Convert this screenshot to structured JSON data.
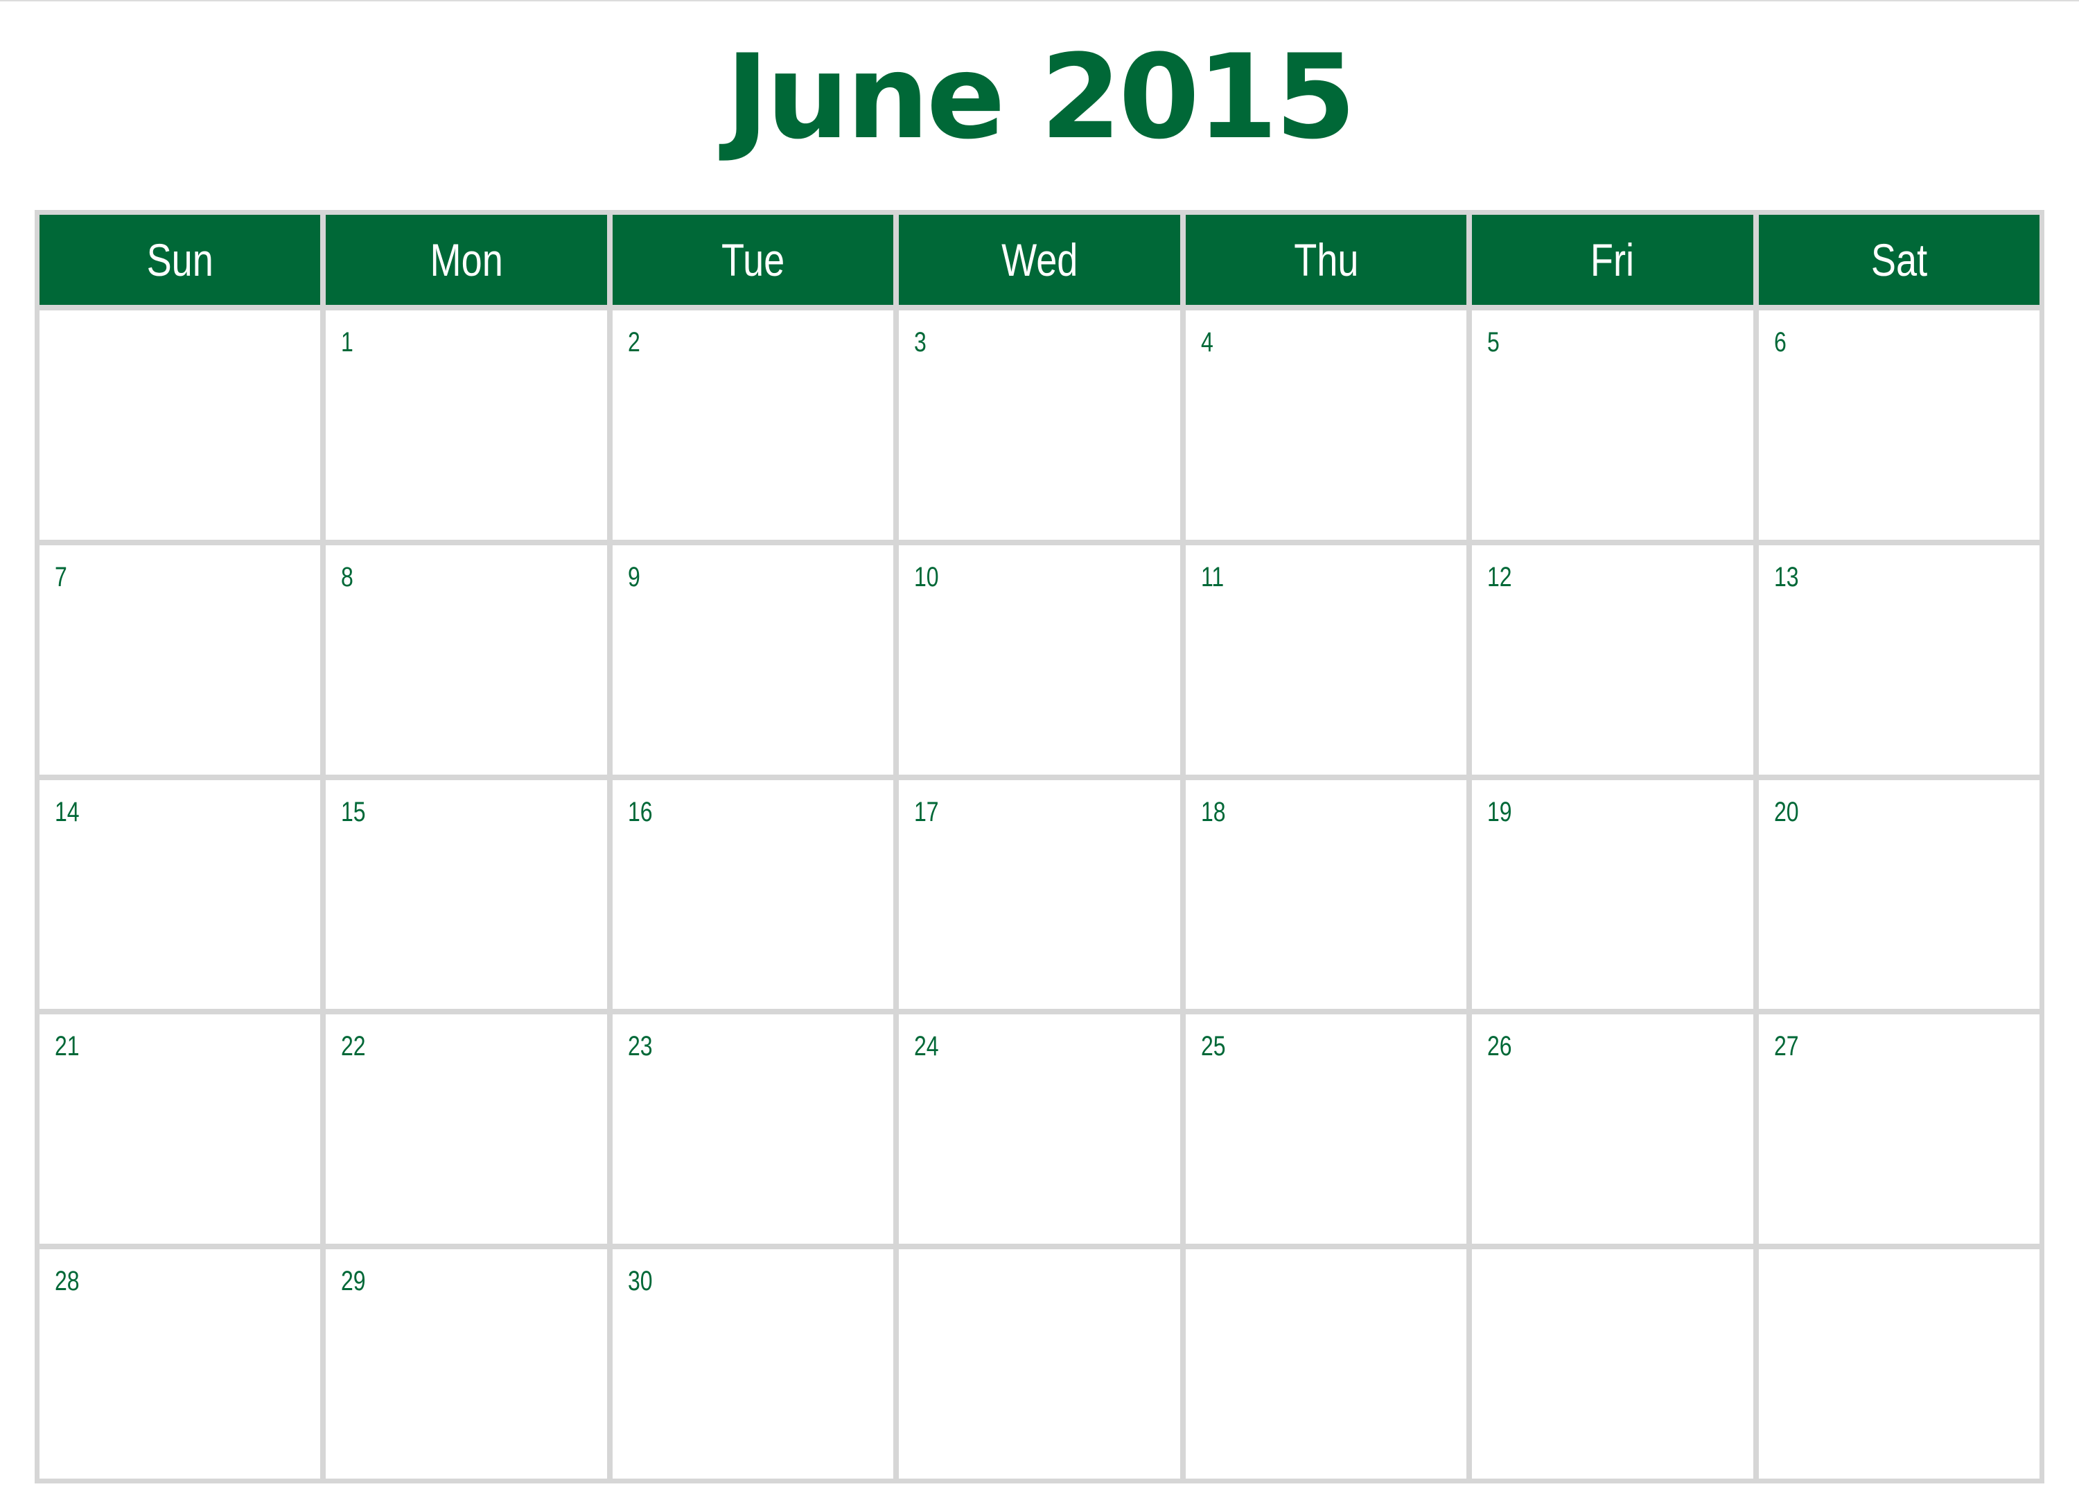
{
  "page": {
    "title": "June 2015"
  },
  "colors": {
    "accent": "#006837",
    "grid": "#d6d6d6",
    "background": "#ffffff"
  },
  "weekdays": [
    "Sun",
    "Mon",
    "Tue",
    "Wed",
    "Thu",
    "Fri",
    "Sat"
  ],
  "weeks": [
    [
      "",
      "1",
      "2",
      "3",
      "4",
      "5",
      "6"
    ],
    [
      "7",
      "8",
      "9",
      "10",
      "11",
      "12",
      "13"
    ],
    [
      "14",
      "15",
      "16",
      "17",
      "18",
      "19",
      "20"
    ],
    [
      "21",
      "22",
      "23",
      "24",
      "25",
      "26",
      "27"
    ],
    [
      "28",
      "29",
      "30",
      "",
      "",
      "",
      ""
    ]
  ]
}
